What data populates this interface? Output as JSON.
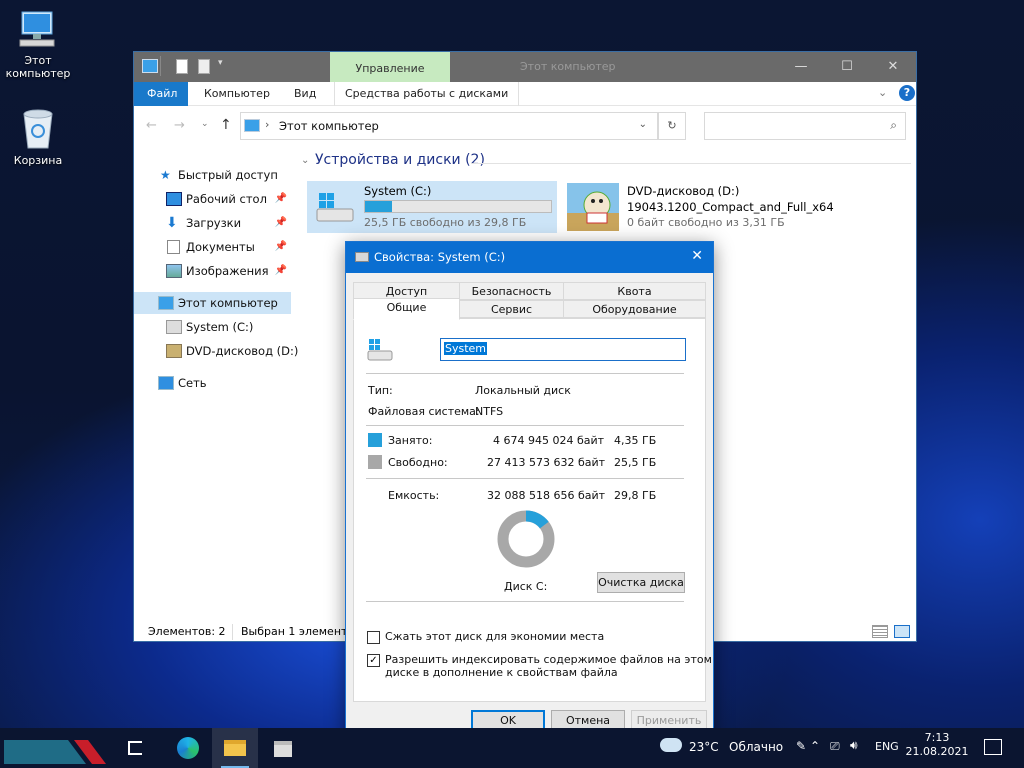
{
  "desktop": {
    "icons": [
      {
        "label": "Этот компьютер",
        "icon": "monitor-icon"
      },
      {
        "label": "Корзина",
        "icon": "recycle-bin-icon"
      }
    ]
  },
  "explorer": {
    "ribbon_context_tab": "Управление",
    "inactive_title": "Этот компьютер",
    "ribbon_tabs": [
      "Файл",
      "Компьютер",
      "Вид",
      "Средства работы с дисками"
    ],
    "address_path": "Этот компьютер",
    "search_placeholder": "",
    "nav": {
      "quick_access": "Быстрый доступ",
      "pinned": [
        "Рабочий стол",
        "Загрузки",
        "Документы",
        "Изображения"
      ],
      "this_pc": "Этот компьютер",
      "drives": [
        "System (C:)",
        "DVD-дисковод (D:)"
      ],
      "network": "Сеть"
    },
    "group_header": "Устройства и диски (2)",
    "drives": [
      {
        "name": "System (C:)",
        "free_text": "25,5 ГБ свободно из 29,8 ГБ",
        "used_fraction": 0.146
      },
      {
        "name": "DVD-дисковод (D:)",
        "subtitle": "19043.1200_Compact_and_Full_x64",
        "free_text": "0 байт свободно из 3,31 ГБ"
      }
    ],
    "status_items": "Элементов: 2",
    "status_selected": "Выбран 1 элемент"
  },
  "dialog": {
    "title": "Свойства: System (C:)",
    "tabs_row1": [
      "Доступ",
      "Безопасность",
      "Квота"
    ],
    "tabs_row2": [
      "Общие",
      "Сервис",
      "Оборудование"
    ],
    "name_value": "System",
    "type_label": "Тип:",
    "type_value": "Локальный диск",
    "fs_label": "Файловая система:",
    "fs_value": "NTFS",
    "used_label": "Занято:",
    "used_bytes": "4 674 945 024 байт",
    "used_gb": "4,35 ГБ",
    "free_label": "Свободно:",
    "free_bytes": "27 413 573 632 байт",
    "free_gb": "25,5 ГБ",
    "cap_label": "Емкость:",
    "cap_bytes": "32 088 518 656 байт",
    "cap_gb": "29,8 ГБ",
    "used_fraction": 0.146,
    "used_color": "#26a0da",
    "free_color": "#a8a8a8",
    "disk_label": "Диск C:",
    "cleanup_button": "Очистка диска",
    "compress_label": "Сжать этот диск для экономии места",
    "index_label_1": "Разрешить индексировать содержимое файлов на этом",
    "index_label_2": "диске в дополнение к свойствам файла",
    "compress_checked": false,
    "index_checked": true,
    "ok": "OK",
    "cancel": "Отмена",
    "apply": "Применить"
  },
  "taskbar": {
    "weather": "23°C",
    "weather_desc": "Облачно",
    "lang": "ENG",
    "time": "7:13",
    "date": "21.08.2021"
  }
}
